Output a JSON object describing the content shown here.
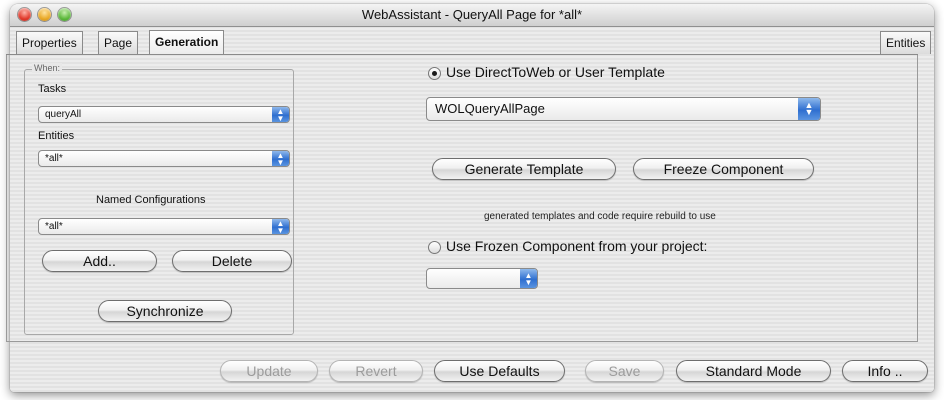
{
  "window": {
    "title": "WebAssistant - QueryAll Page for *all*"
  },
  "tabs": [
    {
      "label": "Properties"
    },
    {
      "label": "Page"
    },
    {
      "label": "Generation",
      "active": true
    }
  ],
  "entities_tab": {
    "label": "Entities"
  },
  "when_group": {
    "legend": "When:",
    "tasks_label": "Tasks",
    "tasks_value": "queryAll",
    "entities_label": "Entities",
    "entities_value": "*all*",
    "named_configurations_label": "Named Configurations",
    "named_configurations_value": "*all*",
    "add_label": "Add..",
    "delete_label": "Delete",
    "synchronize_label": "Synchronize"
  },
  "generation": {
    "option_directtoweb_label": "Use DirectToWeb or User Template",
    "option_directtoweb_selected": true,
    "template_value": "WOLQueryAllPage",
    "generate_template_label": "Generate Template",
    "freeze_component_label": "Freeze Component",
    "rebuild_note": "generated templates and code require rebuild to use",
    "option_frozen_label": "Use Frozen Component from your project:",
    "option_frozen_selected": false,
    "frozen_component_value": ""
  },
  "bottom_bar": {
    "update_label": "Update",
    "revert_label": "Revert",
    "use_defaults_label": "Use Defaults",
    "save_label": "Save",
    "standard_mode_label": "Standard Mode",
    "info_label": "Info .."
  },
  "icons": {
    "popup_arrows": "up-down-arrows-icon"
  },
  "colors": {
    "popup_arrow_blue": "#2f6fd0",
    "close": "#e0382a",
    "minimize": "#e9a825",
    "zoom": "#5bb83a"
  }
}
